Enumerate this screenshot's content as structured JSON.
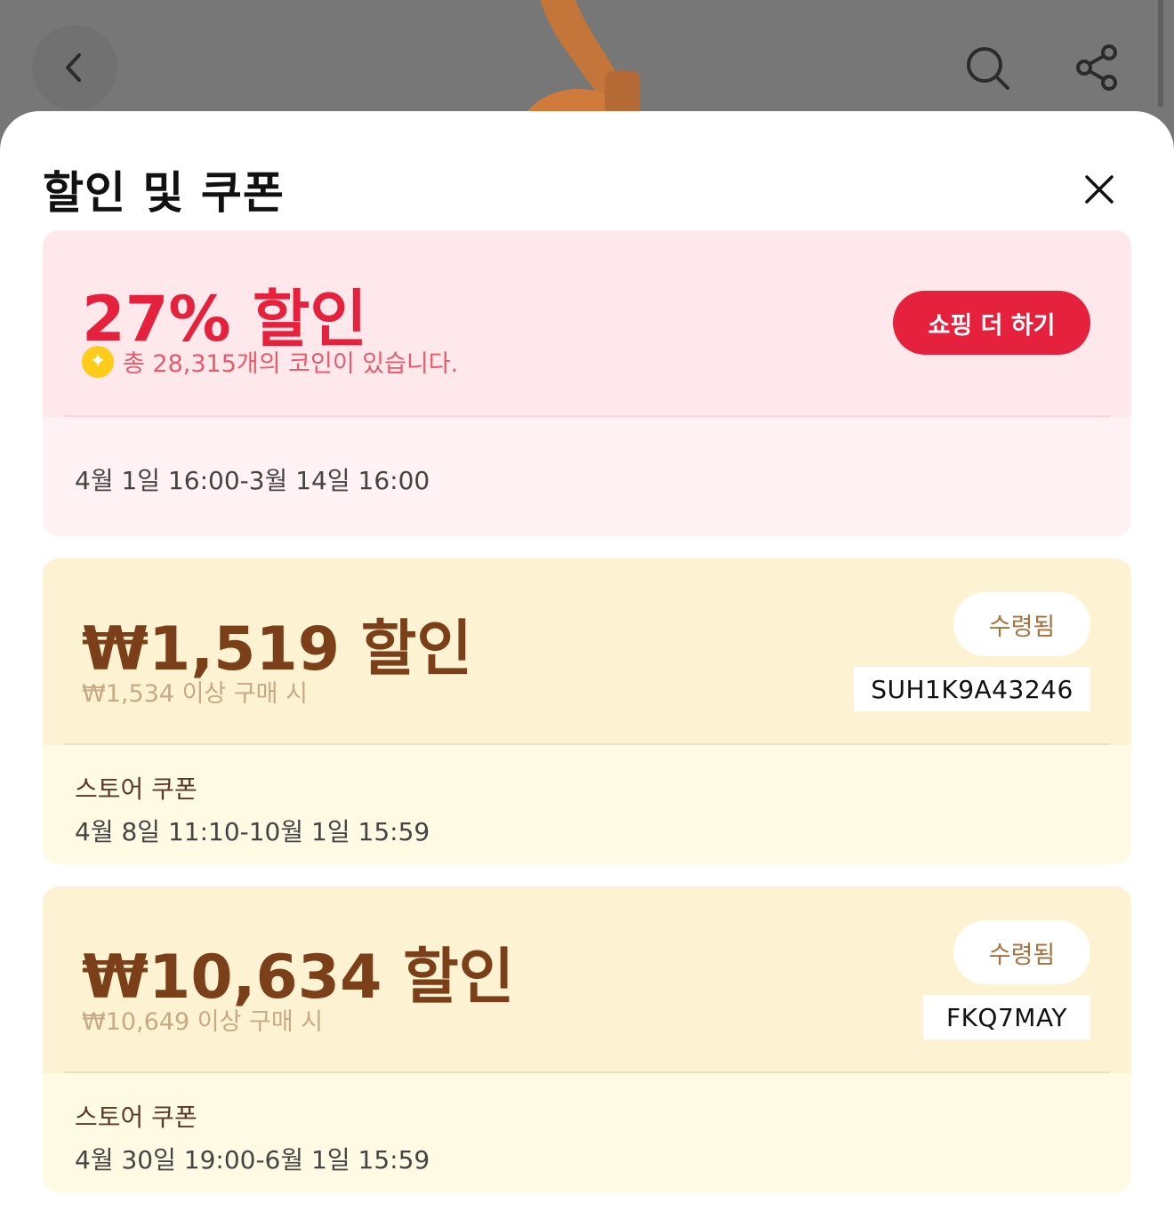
{
  "sheet": {
    "title": "할인 및 쿠폰"
  },
  "promo": {
    "title": "27% 할인",
    "coin_text": "총 28,315개의 코인이 있습니다.",
    "button_label": "쇼핑 더 하기",
    "period": "4월 1일 16:00-3월 14일 16:00"
  },
  "coupons": [
    {
      "amount": "₩1,519 할인",
      "condition": "₩1,534 이상 구매 시",
      "status": "수령됨",
      "code": "SUH1K9A43246",
      "type": "스토어 쿠폰",
      "period": "4월 8일 11:10-10월 1일 15:59"
    },
    {
      "amount": "₩10,634 할인",
      "condition": "₩10,649 이상 구매 시",
      "status": "수령됨",
      "code": "FKQ7MAY",
      "type": "스토어 쿠폰",
      "period": "4월 30일 19:00-6월 1일 15:59"
    }
  ],
  "colors": {
    "accent_red": "#e5213d",
    "coupon_brown": "#7b3f1a",
    "pink_bg": "#ffe8ec",
    "yellow_bg": "#fdf3d2"
  },
  "icons": [
    "back-icon",
    "search-icon",
    "share-icon",
    "close-icon",
    "coin-icon"
  ]
}
